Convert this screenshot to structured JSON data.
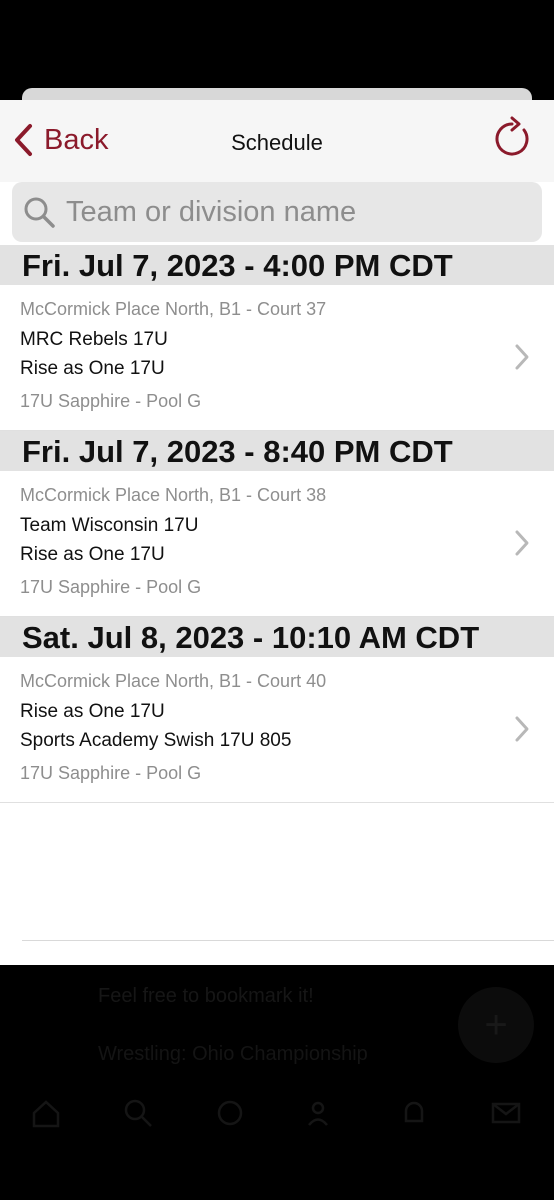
{
  "nav": {
    "back_label": "Back",
    "title": "Schedule"
  },
  "search": {
    "placeholder": "Team or division name"
  },
  "colors": {
    "accent": "#8b1a2b",
    "section_bg": "#e2e2e2",
    "secondary_text": "#8e8e8e"
  },
  "sections": [
    {
      "header": "Fri. Jul 7, 2023 - 4:00 PM CDT",
      "game": {
        "location": "McCormick Place North, B1 - Court 37",
        "team1": "MRC Rebels 17U",
        "team2": "Rise as One 17U",
        "division": "17U Sapphire - Pool G"
      }
    },
    {
      "header": "Fri. Jul 7, 2023 - 8:40 PM CDT",
      "game": {
        "location": "McCormick Place North, B1 - Court 38",
        "team1": "Team Wisconsin 17U",
        "team2": "Rise as One 17U",
        "division": "17U Sapphire - Pool G"
      }
    },
    {
      "header": "Sat. Jul 8, 2023 - 10:10 AM CDT",
      "game": {
        "location": "McCormick Place North, B1 - Court 40",
        "team1": "Rise as One 17U",
        "team2": "Sports Academy Swish 17U 805",
        "division": "17U Sapphire - Pool G"
      }
    }
  ],
  "footer": {
    "line1": "Feel free to bookmark it!",
    "line2": "Wrestling: Ohio Championship",
    "fab_icon": "plus-icon",
    "tabs": [
      "home-icon",
      "search-icon",
      "robot-icon",
      "people-icon",
      "bell-icon",
      "mail-icon"
    ]
  }
}
